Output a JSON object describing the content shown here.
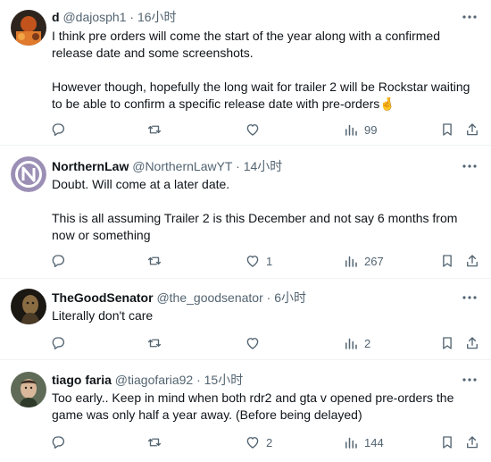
{
  "tweets": [
    {
      "name": "d",
      "handle": "@dajosph1",
      "separator": "·",
      "time": "16小时",
      "text": [
        "I think pre orders will come the start of the year along with a confirmed release date and some screenshots.",
        "However though, hopefully the long wait for trailer 2 will be Rockstar waiting to be able to confirm a specific release date with pre-orders🤞"
      ],
      "replies": "",
      "reposts": "",
      "likes": "",
      "views": "99",
      "avatar_colors": [
        "#3a2b22",
        "#c2531d"
      ]
    },
    {
      "name": "NorthernLaw",
      "handle": "@NorthernLawYT",
      "separator": "·",
      "time": "14小时",
      "text": [
        "Doubt. Will come at a later date.",
        "This is all assuming Trailer 2 is this December and not say 6 months from now or something"
      ],
      "replies": "",
      "reposts": "",
      "likes": "1",
      "views": "267",
      "avatar_colors": [
        "#9b8fb5",
        "#ffffff"
      ]
    },
    {
      "name": "TheGoodSenator",
      "handle": "@the_goodsenator",
      "separator": "·",
      "time": "6小时",
      "text": [
        "Literally don't care"
      ],
      "replies": "",
      "reposts": "",
      "likes": "",
      "views": "2",
      "avatar_colors": [
        "#1b1712",
        "#8a6c43"
      ]
    },
    {
      "name": "tiago faria",
      "handle": "@tiagofaria92",
      "separator": "·",
      "time": "15小时",
      "text": [
        "Too early.. Keep in mind when both rdr2 and gta v opened pre-orders the game was only half a year away. (Before being delayed)"
      ],
      "replies": "",
      "reposts": "",
      "likes": "2",
      "views": "144",
      "avatar_colors": [
        "#5f6b57",
        "#d9b79a"
      ]
    }
  ]
}
